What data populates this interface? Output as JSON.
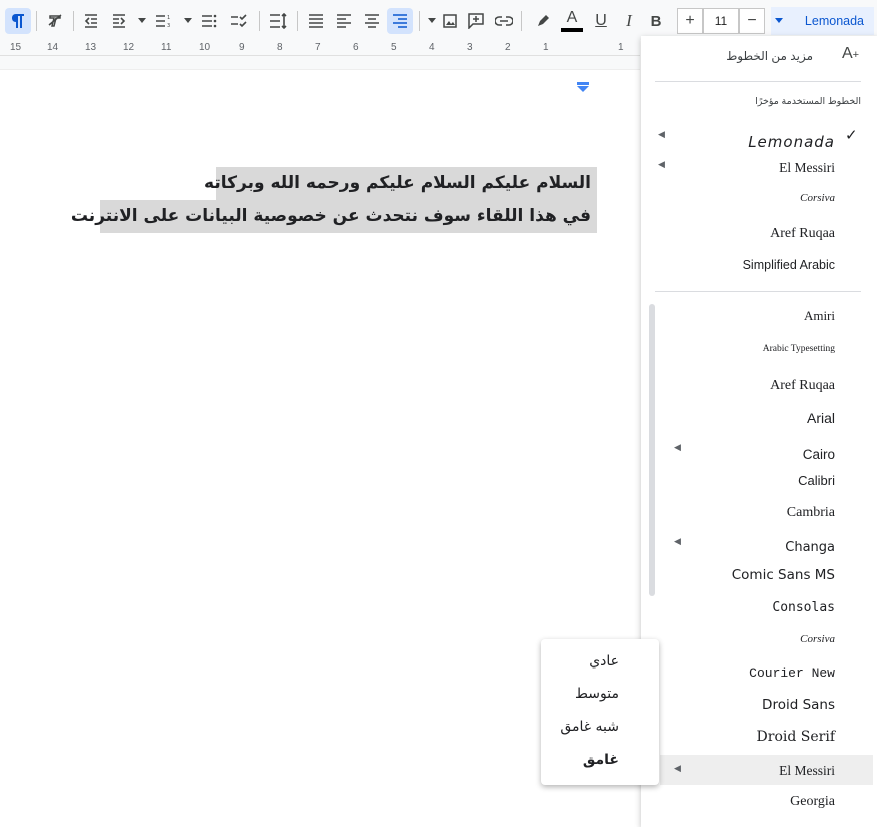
{
  "toolbar": {
    "font_name": "Lemonada",
    "font_size": "11",
    "decrease_size": "−",
    "increase_size": "+",
    "bold": "B",
    "italic": "I",
    "underline": "U",
    "text_color": "A",
    "icons": [
      "rtl-paragraph-icon",
      "clear-formatting-icon",
      "decrease-indent-icon",
      "increase-indent-icon",
      "numbered-list-icon",
      "bulleted-list-icon",
      "checklist-icon",
      "line-spacing-icon",
      "justify-icon",
      "align-left-icon",
      "align-center-icon",
      "align-right-icon",
      "image-icon",
      "comment-icon",
      "link-icon",
      "highlight-icon"
    ]
  },
  "ruler": {
    "ticks": [
      "15",
      "14",
      "13",
      "12",
      "11",
      "10",
      "9",
      "8",
      "7",
      "6",
      "5",
      "4",
      "3",
      "2",
      "1",
      "1"
    ]
  },
  "document": {
    "line1": "السلام عليكم السلام عليكم ورحمه الله وبركاته",
    "line2": "في هذا اللقاء سوف نتحدث عن خصوصية البيانات على الانترنت"
  },
  "font_menu": {
    "more_fonts": "مزيد من الخطوط",
    "recent_title": "الخطوط المستخدمة مؤخرًا",
    "recent": [
      {
        "name": "Lemonada",
        "checked": true,
        "has_submenu": true
      },
      {
        "name": "El Messiri",
        "has_submenu": true
      },
      {
        "name": "Corsiva"
      },
      {
        "name": "Aref Ruqaa"
      },
      {
        "name": "Simplified Arabic"
      }
    ],
    "all": [
      {
        "name": "Amiri"
      },
      {
        "name": "Arabic Typesetting"
      },
      {
        "name": "Aref Ruqaa"
      },
      {
        "name": "Arial"
      },
      {
        "name": "Cairo",
        "has_submenu": true
      },
      {
        "name": "Calibri"
      },
      {
        "name": "Cambria"
      },
      {
        "name": "Changa",
        "has_submenu": true
      },
      {
        "name": "Comic Sans MS"
      },
      {
        "name": "Consolas"
      },
      {
        "name": "Corsiva"
      },
      {
        "name": "Courier New"
      },
      {
        "name": "Droid Sans"
      },
      {
        "name": "Droid Serif"
      },
      {
        "name": "El Messiri",
        "has_submenu": true,
        "hovered": true
      },
      {
        "name": "Georgia"
      }
    ]
  },
  "weight_menu": {
    "items": [
      "عادي",
      "متوسط",
      "شبه غامق",
      "غامق"
    ]
  },
  "colors": {
    "accent": "#0b57d0",
    "selection": "#d9d9d9",
    "toolbar_bg": "#f8f9fa"
  }
}
